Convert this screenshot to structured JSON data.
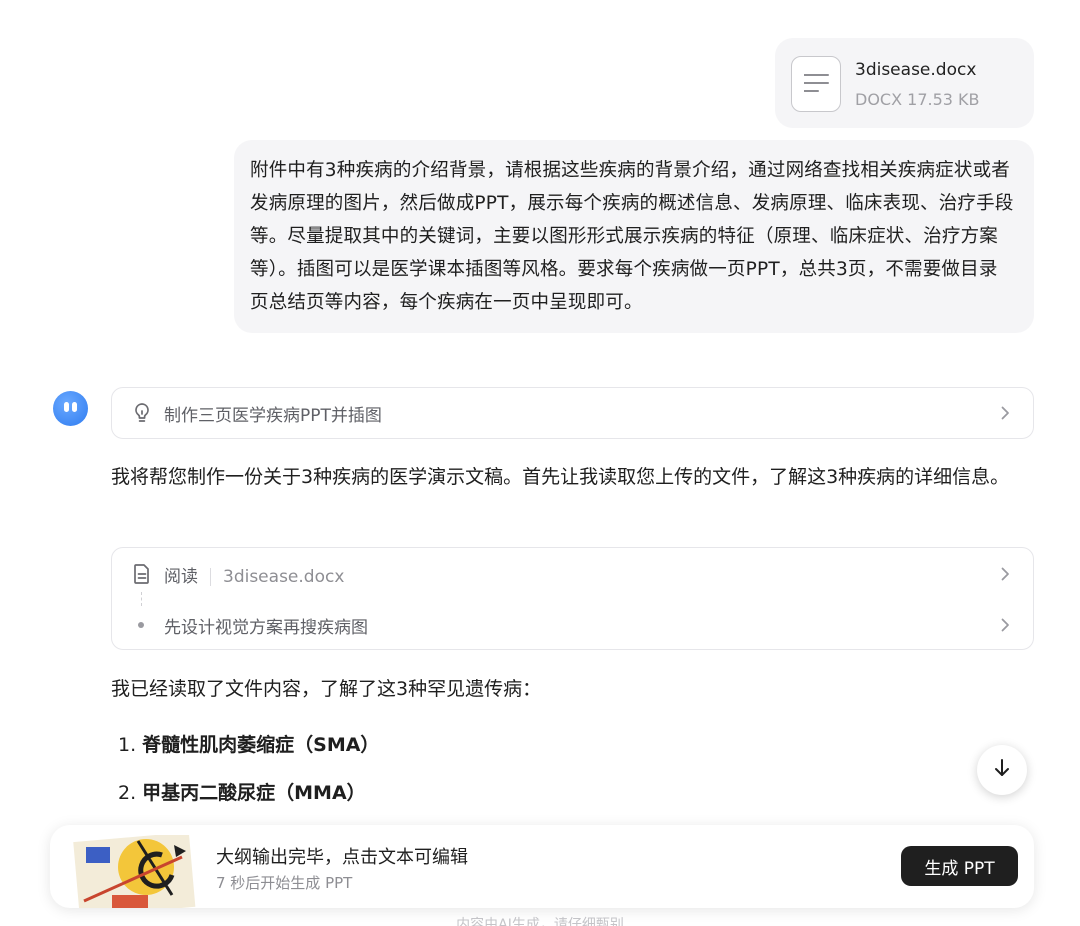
{
  "attachment": {
    "name": "3disease.docx",
    "meta": "DOCX 17.53 KB",
    "icon": "document-icon"
  },
  "user_message": "附件中有3种疾病的介绍背景，请根据这些疾病的背景介绍，通过网络查找相关疾病症状或者发病原理的图片，然后做成PPT，展示每个疾病的概述信息、发病原理、临床表现、治疗手段等。尽量提取其中的关键词，主要以图形形式展示疾病的特征（原理、临床症状、治疗方案等）。插图可以是医学课本插图等风格。要求每个疾病做一页PPT，总共3页，不需要做目录页总结页等内容，每个疾病在一页中呈现即可。",
  "thinking": {
    "label": "制作三页医学疾病PPT并插图",
    "icon": "lightbulb-icon"
  },
  "reply_1": "我将帮您制作一份关于3种疾病的医学演示文稿。首先让我读取您上传的文件，了解这3种疾病的详细信息。",
  "steps": {
    "read_label": "阅读",
    "read_file": "3disease.docx",
    "next_label": "先设计视觉方案再搜疾病图"
  },
  "reply_2": "我已经读取了文件内容，了解了这3种罕见遗传病：",
  "list": [
    {
      "num": "1.",
      "text": "脊髓性肌肉萎缩症（SMA）"
    },
    {
      "num": "2.",
      "text": "甲基丙二酸尿症（MMA）"
    }
  ],
  "panel": {
    "title": "大纲输出完毕，点击文本可编辑",
    "subtitle": "7 秒后开始生成 PPT",
    "button": "生成 PPT"
  },
  "footer": "内容由AI生成，请仔细甄别",
  "colors": {
    "bubble_bg": "#f5f5f7",
    "button_bg": "#1f1f1f",
    "avatar": "#2f7cf0"
  }
}
